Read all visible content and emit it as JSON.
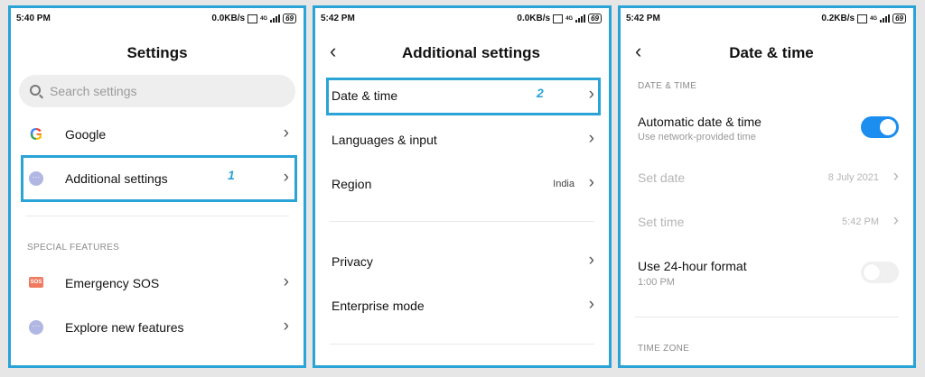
{
  "panel1": {
    "status": {
      "time": "5:40 PM",
      "speed": "0.0KB/s",
      "net": "4G",
      "battery": "69"
    },
    "title": "Settings",
    "search_placeholder": "Search settings",
    "items": [
      {
        "label": "Google"
      },
      {
        "label": "Additional settings"
      }
    ],
    "step": "1",
    "section": "SPECIAL FEATURES",
    "special_items": [
      {
        "label": "Emergency SOS",
        "icon_text": "SOS"
      },
      {
        "label": "Explore new features"
      }
    ]
  },
  "panel2": {
    "status": {
      "time": "5:42 PM",
      "speed": "0.0KB/s",
      "net": "4G",
      "battery": "69"
    },
    "title": "Additional settings",
    "items": [
      {
        "label": "Date & time"
      },
      {
        "label": "Languages & input"
      },
      {
        "label": "Region",
        "value": "India"
      },
      {
        "label": "Privacy"
      },
      {
        "label": "Enterprise mode"
      }
    ],
    "step": "2"
  },
  "panel3": {
    "status": {
      "time": "5:42 PM",
      "speed": "0.2KB/s",
      "net": "4G",
      "battery": "69"
    },
    "title": "Date & time",
    "section1": "DATE & TIME",
    "auto": {
      "label": "Automatic date & time",
      "sub": "Use network-provided time",
      "enabled": true
    },
    "set_date": {
      "label": "Set date",
      "value": "8 July 2021"
    },
    "set_time": {
      "label": "Set time",
      "value": "5:42 PM"
    },
    "format24": {
      "label": "Use 24-hour format",
      "sub": "1:00 PM",
      "enabled": false
    },
    "section2": "TIME ZONE"
  },
  "colors": {
    "highlight": "#2aa3d6",
    "toggle_on": "#1c8ef0"
  }
}
